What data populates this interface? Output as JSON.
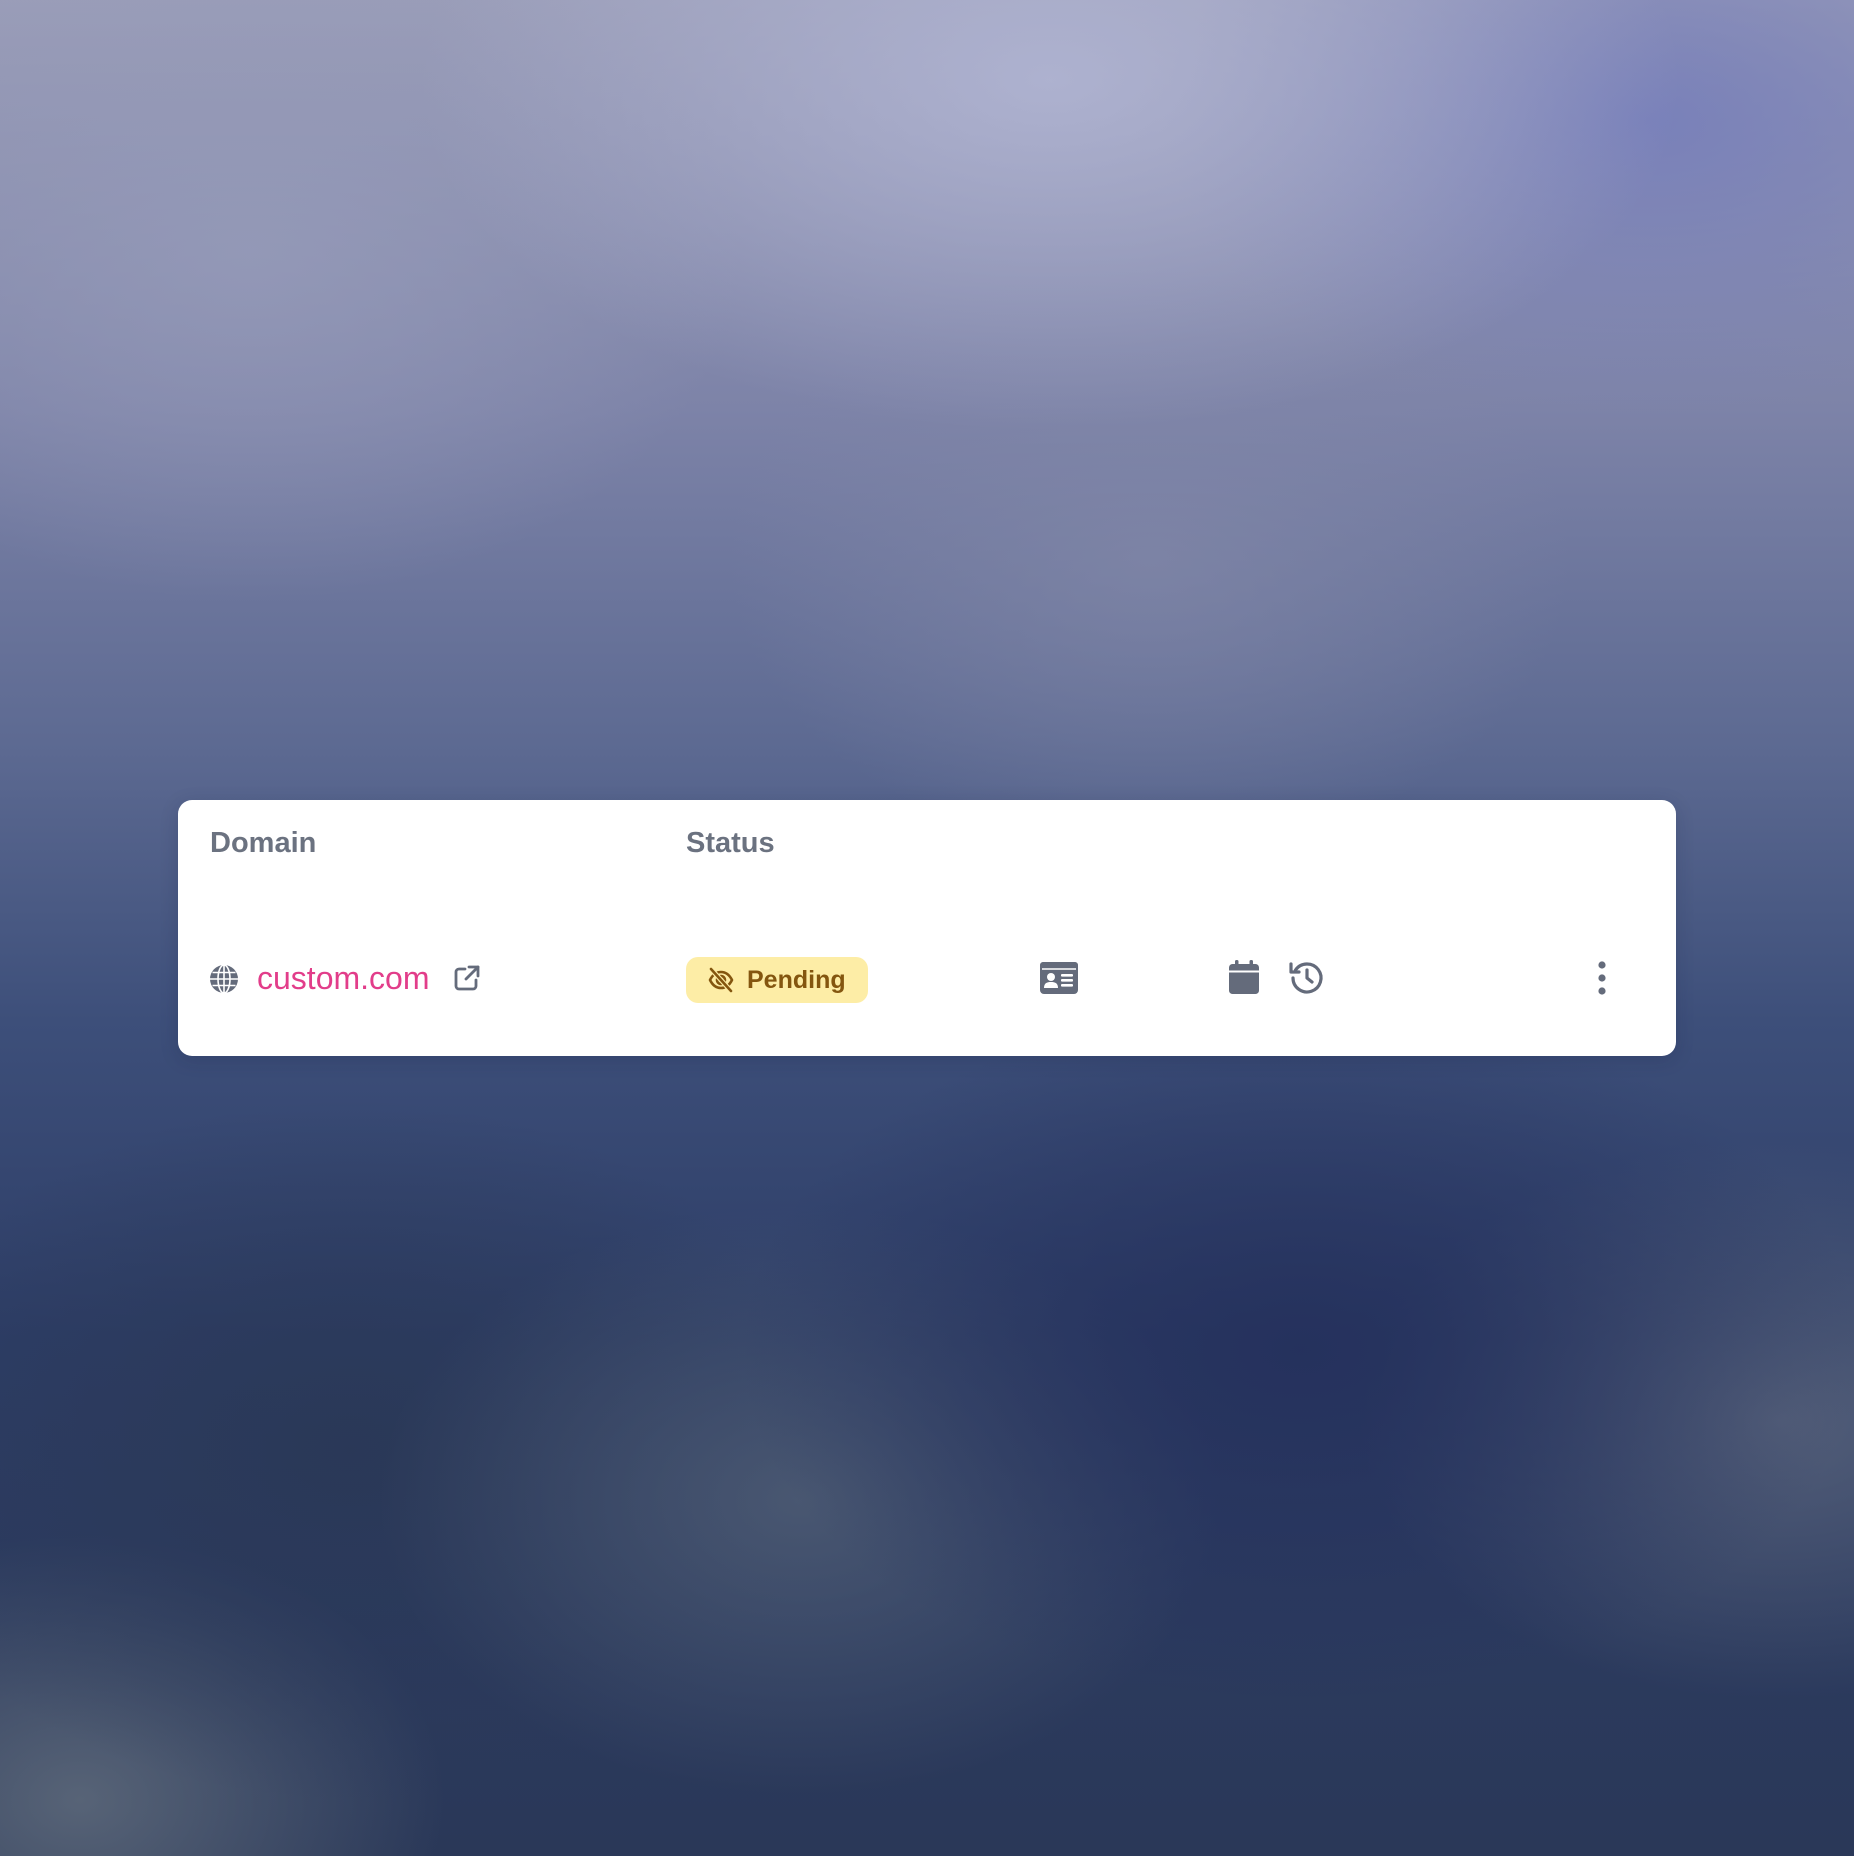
{
  "table": {
    "headers": {
      "domain": "Domain",
      "status": "Status"
    },
    "rows": [
      {
        "domain": "custom.com",
        "status": "Pending",
        "icons": [
          "globe-icon",
          "external-link-icon",
          "eye-slash-icon",
          "id-card-icon",
          "calendar-icon",
          "history-icon",
          "more-vertical-icon"
        ]
      }
    ]
  },
  "colors": {
    "domain_link": "#e23d8a",
    "header_text": "#6b7280",
    "icon": "#646b7b",
    "pending_bg": "#fdeda6",
    "pending_text": "#84560f"
  }
}
